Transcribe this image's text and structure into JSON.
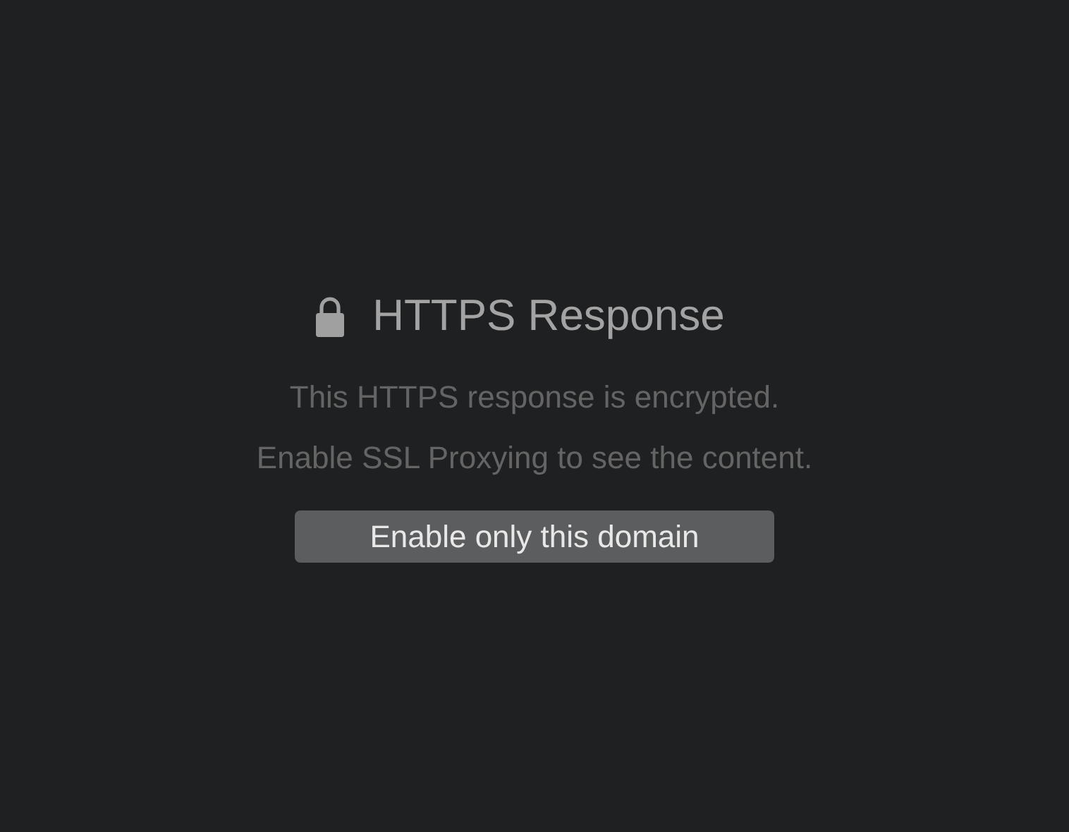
{
  "title": "HTTPS Response",
  "messages": [
    "This HTTPS response is encrypted.",
    "Enable SSL Proxying to see the content."
  ],
  "button": "Enable only this domain"
}
